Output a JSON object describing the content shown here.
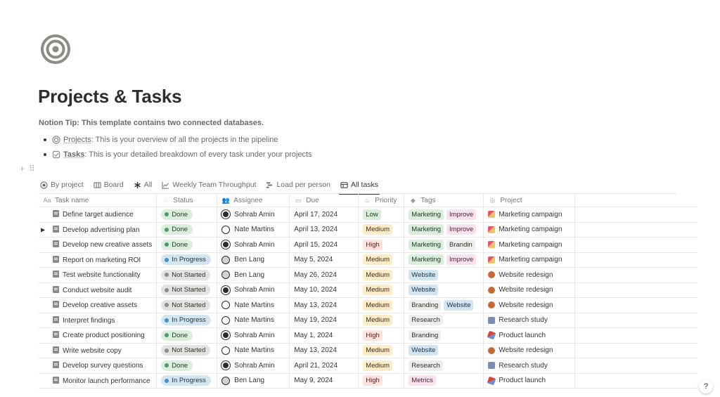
{
  "page": {
    "icon": "target-icon",
    "title": "Projects & Tasks",
    "tip": "Notion Tip: This template contains two connected databases.",
    "bullets": [
      {
        "icon": "projects-icon",
        "link": "Projects",
        "bold": false,
        "text": ": This is your overview of all the projects in the pipeline"
      },
      {
        "icon": "tasks-icon",
        "link": "Tasks",
        "bold": true,
        "text": ": This is your detailed breakdown of every task under your projects"
      }
    ]
  },
  "views": [
    {
      "icon": "target-icon",
      "label": "By project"
    },
    {
      "icon": "board-icon",
      "label": "Board"
    },
    {
      "icon": "asterisk-icon",
      "label": "All"
    },
    {
      "icon": "chart-icon",
      "label": "Weekly Team Throughput"
    },
    {
      "icon": "timeline-icon",
      "label": "Load per person"
    },
    {
      "icon": "table-icon",
      "label": "All tasks",
      "active": true
    }
  ],
  "columns": [
    {
      "icon": "text-icon",
      "glyph": "Aa",
      "label": "Task name"
    },
    {
      "icon": "status-icon",
      "glyph": "◌",
      "label": "Status"
    },
    {
      "icon": "people-icon",
      "glyph": "👥",
      "label": "Assignee"
    },
    {
      "icon": "calendar-icon",
      "glyph": "▭",
      "label": "Due"
    },
    {
      "icon": "fire-icon",
      "glyph": "♨",
      "label": "Priority"
    },
    {
      "icon": "tag-icon",
      "glyph": "◆",
      "label": "Tags"
    },
    {
      "icon": "relation-icon",
      "glyph": "◎",
      "label": "Project"
    },
    {
      "icon": "",
      "glyph": "",
      "label": ""
    }
  ],
  "rows": [
    {
      "name": "Define target audience",
      "status": "Done",
      "assignee": "Sohrab Amin",
      "due": "April 17, 2024",
      "priority": "Low",
      "tags": [
        "Marketing",
        "Improve"
      ],
      "project": "Marketing campaign",
      "toggle": false
    },
    {
      "name": "Develop advertising plan",
      "status": "Done",
      "assignee": "Nate Martins",
      "due": "April 13, 2024",
      "priority": "Medium",
      "tags": [
        "Marketing",
        "Improve"
      ],
      "project": "Marketing campaign",
      "toggle": true
    },
    {
      "name": "Develop new creative assets",
      "status": "Done",
      "assignee": "Sohrab Amin",
      "due": "April 15, 2024",
      "priority": "High",
      "tags": [
        "Marketing",
        "Brandin"
      ],
      "project": "Marketing campaign",
      "toggle": false
    },
    {
      "name": "Report on marketing ROI",
      "status": "In Progress",
      "assignee": "Ben Lang",
      "due": "May 5, 2024",
      "priority": "Medium",
      "tags": [
        "Marketing",
        "Improve"
      ],
      "project": "Marketing campaign",
      "toggle": false
    },
    {
      "name": "Test website functionality",
      "status": "Not Started",
      "assignee": "Ben Lang",
      "due": "May 26, 2024",
      "priority": "Medium",
      "tags": [
        "Website"
      ],
      "project": "Website redesign",
      "toggle": false
    },
    {
      "name": "Conduct website audit",
      "status": "Not Started",
      "assignee": "Sohrab Amin",
      "due": "May 10, 2024",
      "priority": "Medium",
      "tags": [
        "Website"
      ],
      "project": "Website redesign",
      "toggle": false
    },
    {
      "name": "Develop creative assets",
      "status": "Not Started",
      "assignee": "Nate Martins",
      "due": "May 13, 2024",
      "priority": "Medium",
      "tags": [
        "Branding",
        "Website"
      ],
      "project": "Website redesign",
      "toggle": false
    },
    {
      "name": "Interpret findings",
      "status": "In Progress",
      "assignee": "Nate Martins",
      "due": "May 19, 2024",
      "priority": "Medium",
      "tags": [
        "Research"
      ],
      "project": "Research study",
      "toggle": false
    },
    {
      "name": "Create product positioning",
      "status": "Done",
      "assignee": "Sohrab Amin",
      "due": "May 1, 2024",
      "priority": "High",
      "tags": [
        "Branding"
      ],
      "project": "Product launch",
      "toggle": false
    },
    {
      "name": "Write website copy",
      "status": "Not Started",
      "assignee": "Nate Martins",
      "due": "May 13, 2024",
      "priority": "Medium",
      "tags": [
        "Website"
      ],
      "project": "Website redesign",
      "toggle": false
    },
    {
      "name": "Develop survey questions",
      "status": "Done",
      "assignee": "Sohrab Amin",
      "due": "April 21, 2024",
      "priority": "Medium",
      "tags": [
        "Research"
      ],
      "project": "Research study",
      "toggle": false
    },
    {
      "name": "Monitor launch performance",
      "status": "In Progress",
      "assignee": "Ben Lang",
      "due": "May 9, 2024",
      "priority": "High",
      "tags": [
        "Metrics"
      ],
      "project": "Product launch",
      "toggle": false
    }
  ],
  "help_button": "?"
}
